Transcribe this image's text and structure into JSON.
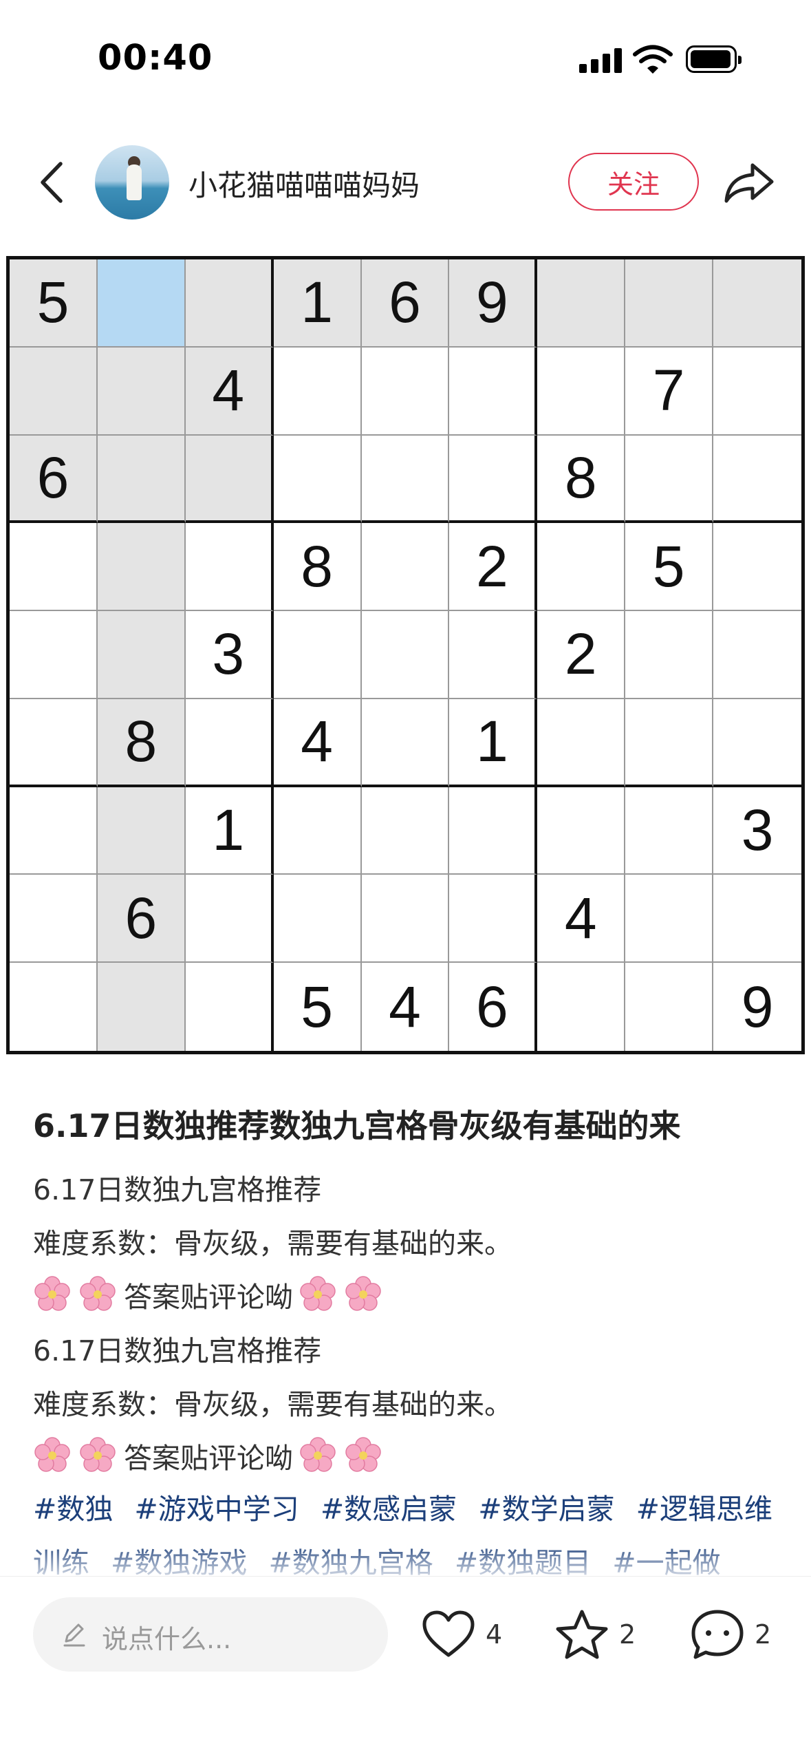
{
  "status_bar": {
    "time": "00:40"
  },
  "header": {
    "username": "小花猫喵喵喵妈妈",
    "follow_label": "关注"
  },
  "sudoku": {
    "rows": [
      [
        "5",
        "",
        "",
        "1",
        "6",
        "9",
        "",
        "",
        ""
      ],
      [
        "",
        "",
        "4",
        "",
        "",
        "",
        "",
        "7",
        ""
      ],
      [
        "6",
        "",
        "",
        "",
        "",
        "",
        "8",
        "",
        ""
      ],
      [
        "",
        "",
        "",
        "8",
        "",
        "2",
        "",
        "5",
        ""
      ],
      [
        "",
        "",
        "3",
        "",
        "",
        "",
        "2",
        "",
        ""
      ],
      [
        "",
        "8",
        "",
        "4",
        "",
        "1",
        "",
        "",
        ""
      ],
      [
        "",
        "",
        "1",
        "",
        "",
        "",
        "",
        "",
        "3"
      ],
      [
        "",
        "6",
        "",
        "",
        "",
        "",
        "4",
        "",
        ""
      ],
      [
        "",
        "",
        "",
        "5",
        "4",
        "6",
        "",
        "",
        "9"
      ]
    ],
    "selected_cell": [
      0,
      1
    ]
  },
  "post": {
    "title": "6.17日数独推荐数独九宫格骨灰级有基础的来",
    "line1": "6.17日数独九宫格推荐",
    "line2": "难度系数：骨灰级，需要有基础的来。",
    "line3": "答案贴评论呦",
    "line4": "6.17日数独九宫格推荐",
    "line5": "难度系数：骨灰级，需要有基础的来。",
    "line6": "答案贴评论呦",
    "tags": [
      "#数独",
      "#游戏中学习",
      "#数感启蒙",
      "#数学启蒙",
      "#逻辑思维训练",
      "#数独游戏",
      "#数独九宫格",
      "#数独题目",
      "#一起做"
    ]
  },
  "bottom_bar": {
    "comment_placeholder": "说点什么...",
    "like_count": "4",
    "collect_count": "2",
    "comment_count": "2"
  },
  "colors": {
    "accent": "#e0354f",
    "tag": "#1c3f7a",
    "highlight": "#e4e4e4",
    "selected": "#b5d9f3"
  }
}
